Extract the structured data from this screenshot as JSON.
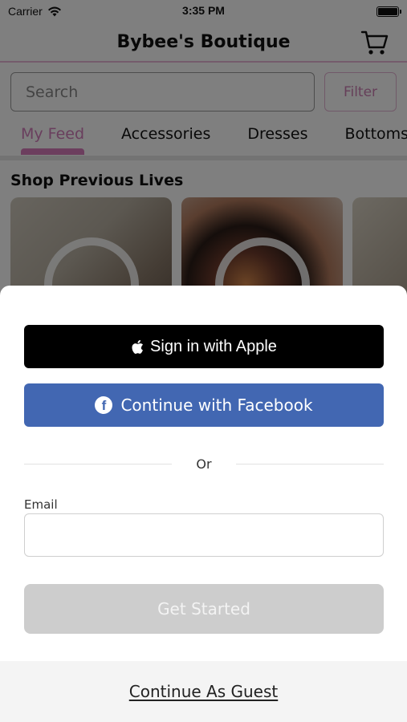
{
  "status_bar": {
    "carrier": "Carrier",
    "time": "3:35 PM"
  },
  "header": {
    "title": "Bybee's Boutique",
    "cart_icon": "cart-icon"
  },
  "search": {
    "placeholder": "Search",
    "filter_label": "Filter"
  },
  "tabs": [
    {
      "label": "My Feed",
      "active": true
    },
    {
      "label": "Accessories",
      "active": false
    },
    {
      "label": "Dresses",
      "active": false
    },
    {
      "label": "Bottoms",
      "active": false
    }
  ],
  "section": {
    "title": "Shop Previous Lives"
  },
  "sheet": {
    "apple_label": "Sign in with Apple",
    "facebook_label": "Continue with Facebook",
    "or_label": "Or",
    "email_label": "Email",
    "email_value": "",
    "get_started_label": "Get Started",
    "guest_label": "Continue As Guest"
  },
  "colors": {
    "accent_pink": "#d37dbb",
    "facebook_blue": "#4267b2",
    "apple_black": "#000000",
    "disabled_gray": "#cdcdcd"
  }
}
